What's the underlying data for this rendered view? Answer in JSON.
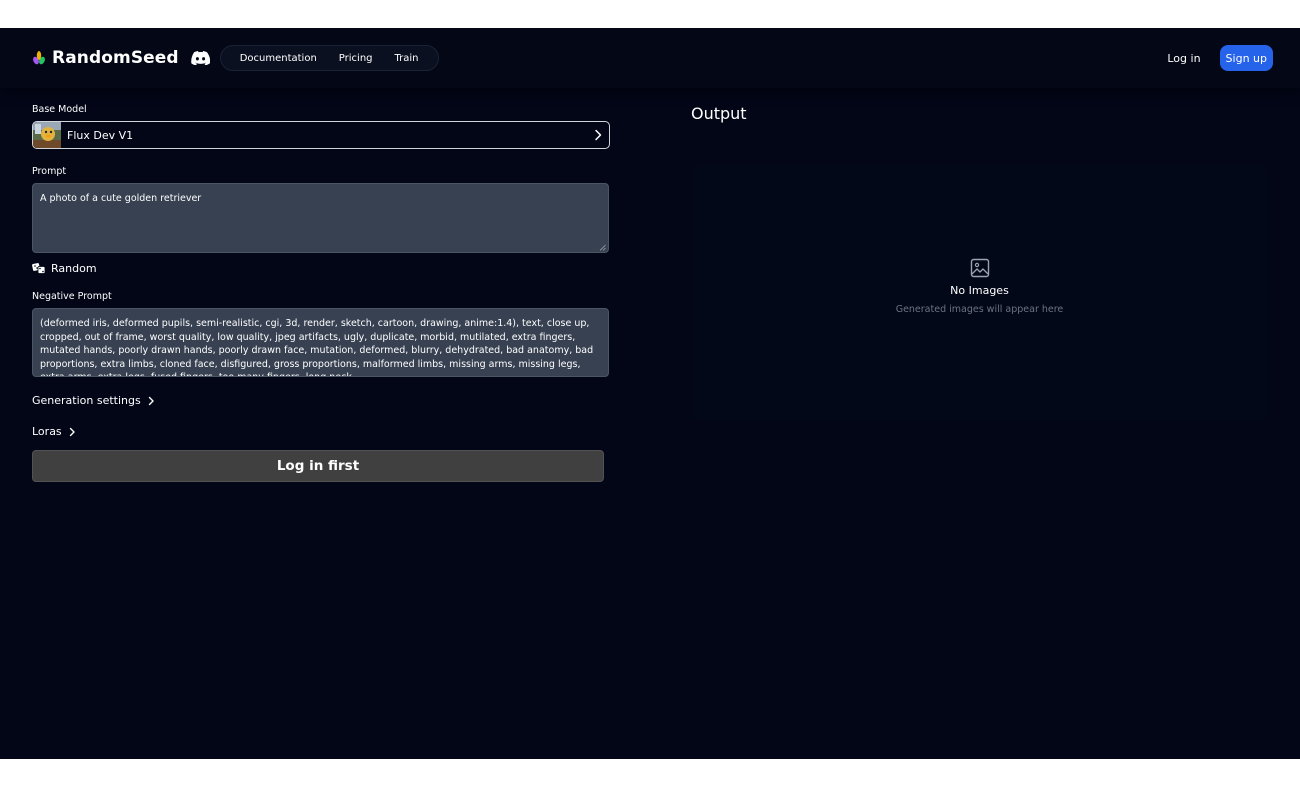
{
  "header": {
    "brand": "RandomSeed",
    "nav": [
      "Documentation",
      "Pricing",
      "Train"
    ],
    "login": "Log in",
    "signup": "Sign up"
  },
  "form": {
    "base_model_label": "Base Model",
    "base_model_value": "Flux Dev V1",
    "prompt_label": "Prompt",
    "prompt_value": "A photo of a cute golden retriever",
    "random_label": "Random",
    "negative_prompt_label": "Negative Prompt",
    "negative_prompt_value": "(deformed iris, deformed pupils, semi-realistic, cgi, 3d, render, sketch, cartoon, drawing, anime:1.4), text, close up, cropped, out of frame, worst quality, low quality, jpeg artifacts, ugly, duplicate, morbid, mutilated, extra fingers, mutated hands, poorly drawn hands, poorly drawn face, mutation, deformed, blurry, dehydrated, bad anatomy, bad proportions, extra limbs, cloned face, disfigured, gross proportions, malformed limbs, missing arms, missing legs, extra arms, extra legs, fused fingers, too many fingers, long neck",
    "generation_settings_label": "Generation settings",
    "loras_label": "Loras",
    "submit_label": "Log in first"
  },
  "output": {
    "title": "Output",
    "empty_title": "No Images",
    "empty_subtitle": "Generated images will appear here"
  },
  "icons": {
    "brand_logo": "leaf-logo-icon",
    "discord": "discord-icon",
    "model_thumbnail": "model-thumbnail",
    "chevron": "chevron-right-icon",
    "dice": "dice-icon",
    "empty_image": "image-icon"
  },
  "colors": {
    "background": "#020617",
    "input_bg": "#374151",
    "primary": "#2563eb",
    "disabled_button": "#404040",
    "muted_text": "#6b7280"
  }
}
